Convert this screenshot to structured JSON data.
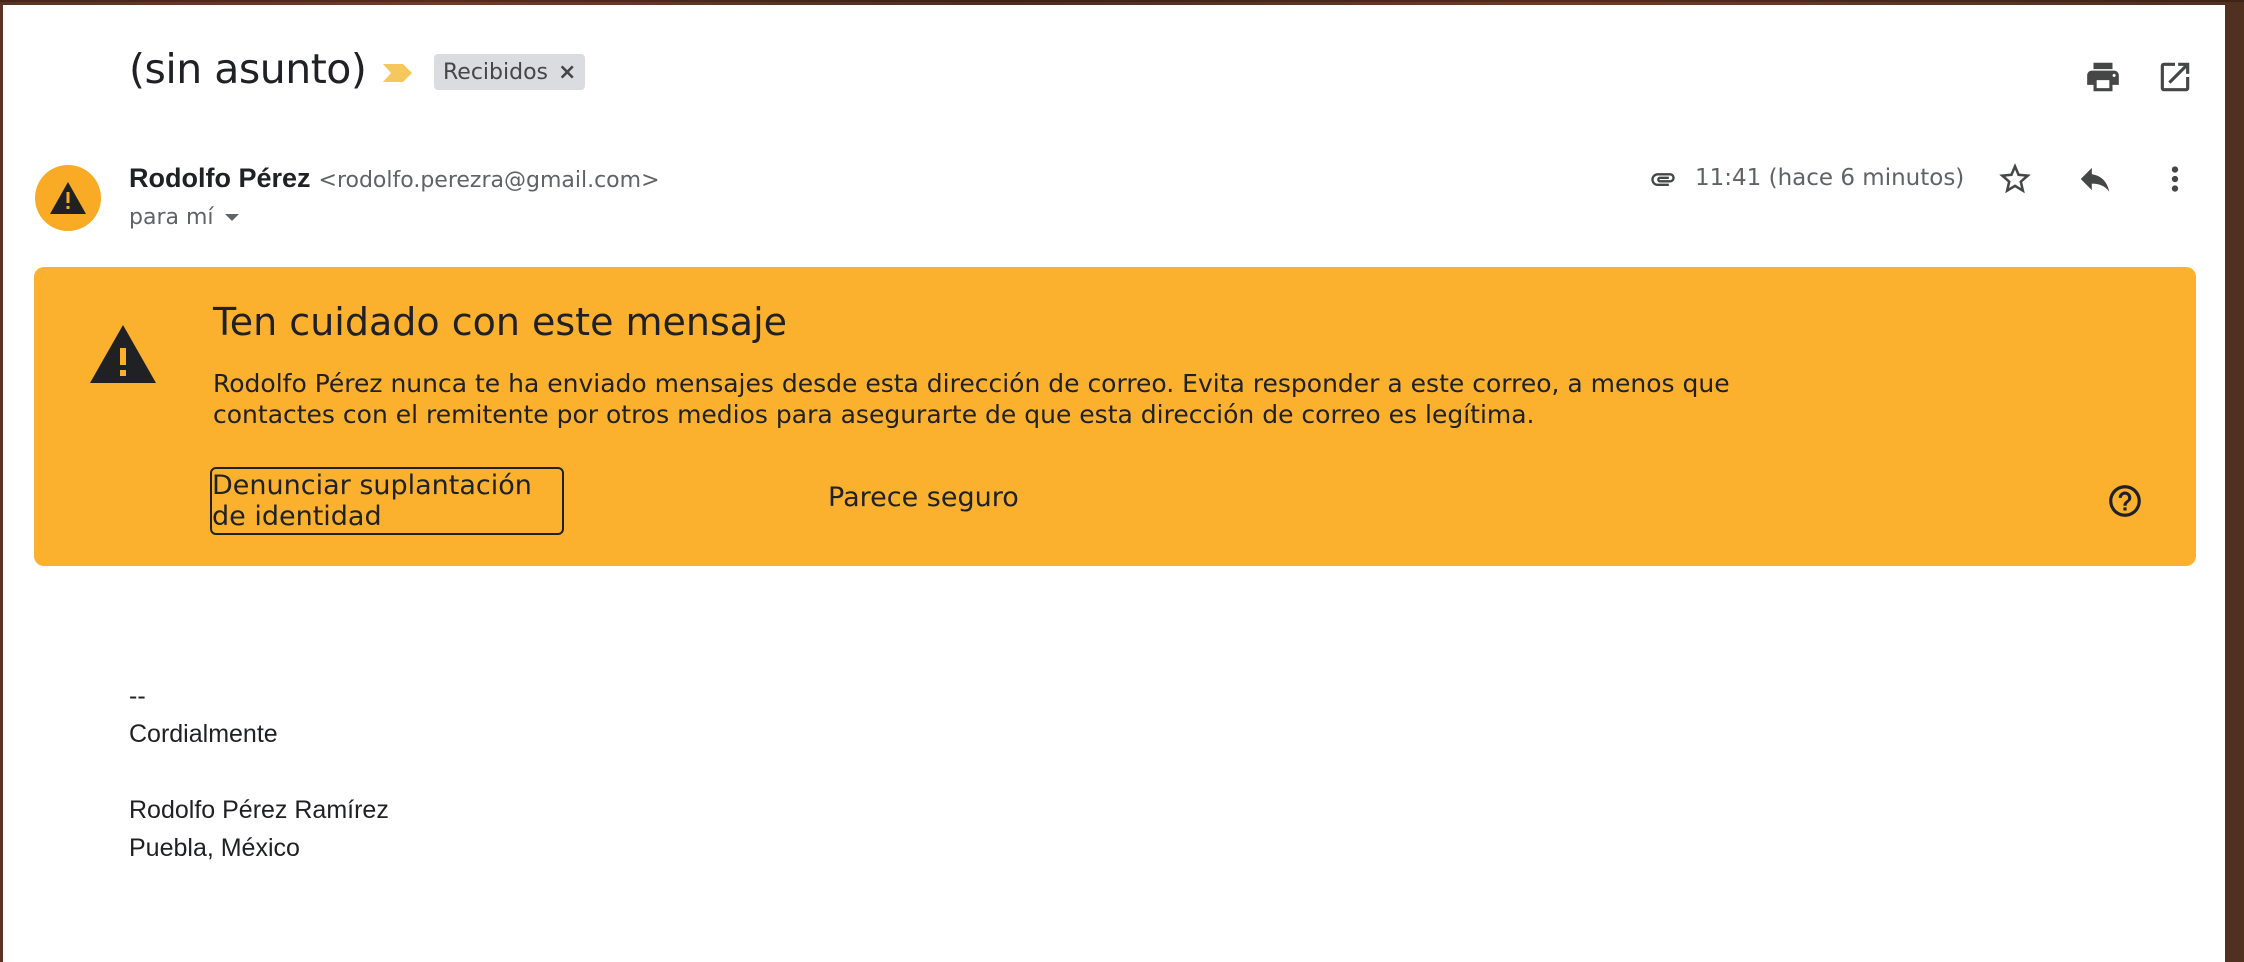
{
  "subject": "(sin asunto)",
  "label_chip": {
    "text": "Recibidos",
    "remove": "×"
  },
  "sender": {
    "name": "Rodolfo Pérez",
    "email": "<rodolfo.perezra@gmail.com>",
    "recipient": "para mí"
  },
  "time": "11:41 (hace 6 minutos)",
  "icons": {
    "importance": "importance-marker-icon",
    "print": "print-icon",
    "open_new_window": "open-in-new-icon",
    "attachment": "paperclip-icon",
    "star": "star-outline-icon",
    "reply": "reply-icon",
    "more": "more-vert-icon",
    "warning": "warning-icon",
    "help": "help-circle-icon"
  },
  "warning_banner": {
    "title": "Ten cuidado con este mensaje",
    "text_line1": "Rodolfo Pérez nunca te ha enviado mensajes desde esta dirección de correo. Evita responder a este correo, a menos que",
    "text_line2": "contactes con el remitente por otros medios para asegurarte de que esta dirección de correo es legítima.",
    "report_button": "Denunciar suplantación de identidad",
    "safe_button": "Parece seguro"
  },
  "body": {
    "line1": "--",
    "line2": "Cordialmente",
    "line3": "",
    "line4": "Rodolfo Pérez Ramírez",
    "line5": "Puebla, México"
  },
  "colors": {
    "banner": "#fbb12e",
    "avatar": "#f9ab25",
    "chip": "#dadce0",
    "importance": "#f6c75c",
    "text": "#202124"
  }
}
